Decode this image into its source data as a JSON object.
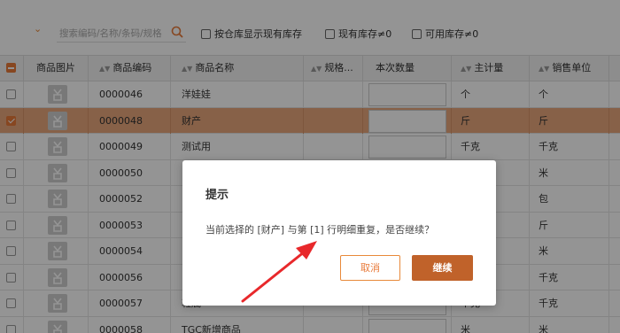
{
  "toolbar": {
    "search_placeholder": "搜索编码/名称/条码/规格",
    "options": [
      {
        "label": "按仓库显示现有库存",
        "checked": false
      },
      {
        "label": "现有库存≠0",
        "checked": false
      },
      {
        "label": "可用库存≠0",
        "checked": false
      }
    ]
  },
  "table": {
    "columns": [
      "商品图片",
      "商品编码",
      "商品名称",
      "规格...",
      "本次数量",
      "主计量",
      "销售单位"
    ],
    "rows": [
      {
        "code": "0000046",
        "name": "洋娃娃",
        "unit": "个",
        "sale_unit": "个",
        "selected": false
      },
      {
        "code": "0000048",
        "name": "财产",
        "unit": "斤",
        "sale_unit": "斤",
        "selected": true
      },
      {
        "code": "0000049",
        "name": "测试用",
        "unit": "千克",
        "sale_unit": "千克",
        "selected": false
      },
      {
        "code": "0000050",
        "name": "",
        "unit": "",
        "sale_unit": "米",
        "selected": false
      },
      {
        "code": "0000052",
        "name": "",
        "unit": "",
        "sale_unit": "包",
        "selected": false
      },
      {
        "code": "0000053",
        "name": "",
        "unit": "",
        "sale_unit": "斤",
        "selected": false
      },
      {
        "code": "0000054",
        "name": "",
        "unit": "",
        "sale_unit": "米",
        "selected": false
      },
      {
        "code": "0000056",
        "name": "",
        "unit": "",
        "sale_unit": "千克",
        "selected": false
      },
      {
        "code": "0000057",
        "name": "鞋底",
        "unit": "千克",
        "sale_unit": "千克",
        "selected": false
      },
      {
        "code": "0000058",
        "name": "TGC新增商品",
        "unit": "米",
        "sale_unit": "米",
        "selected": false
      }
    ]
  },
  "dialog": {
    "title": "提示",
    "message": "当前选择的 [财产] 与第 [1] 行明细重复，是否继续？",
    "cancel_label": "取消",
    "confirm_label": "继续"
  },
  "colors": {
    "accent": "#e87a3a",
    "selected_row": "#e8a77c",
    "confirm_button": "#c0622a",
    "annotation_arrow": "#e8282b"
  }
}
